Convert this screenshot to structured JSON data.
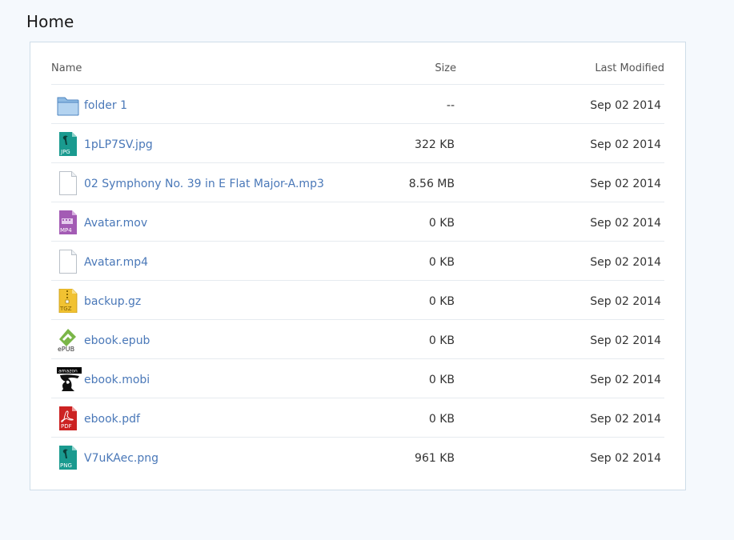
{
  "page": {
    "title": "Home"
  },
  "table": {
    "headers": {
      "name": "Name",
      "size": "Size",
      "modified": "Last Modified"
    },
    "rows": [
      {
        "icon": "folder-icon",
        "name": "folder 1",
        "size": "--",
        "modified": "Sep 02 2014"
      },
      {
        "icon": "jpg-file-icon",
        "icon_label": "JPG",
        "name": "1pLP7SV.jpg",
        "size": "322 KB",
        "modified": "Sep 02 2014"
      },
      {
        "icon": "generic-file-icon",
        "name": "02 Symphony No. 39 in E Flat Major-A.mp3",
        "size": "8.56 MB",
        "modified": "Sep 02 2014"
      },
      {
        "icon": "mp4-file-icon",
        "icon_label": "MP4",
        "name": "Avatar.mov",
        "size": "0 KB",
        "modified": "Sep 02 2014"
      },
      {
        "icon": "generic-file-icon",
        "name": "Avatar.mp4",
        "size": "0 KB",
        "modified": "Sep 02 2014"
      },
      {
        "icon": "tgz-file-icon",
        "icon_label": "TGZ",
        "name": "backup.gz",
        "size": "0 KB",
        "modified": "Sep 02 2014"
      },
      {
        "icon": "epub-file-icon",
        "icon_label": "ePUB",
        "name": "ebook.epub",
        "size": "0 KB",
        "modified": "Sep 02 2014"
      },
      {
        "icon": "amazon-file-icon",
        "icon_label": "amazon",
        "name": "ebook.mobi",
        "size": "0 KB",
        "modified": "Sep 02 2014"
      },
      {
        "icon": "pdf-file-icon",
        "icon_label": "PDF",
        "name": "ebook.pdf",
        "size": "0 KB",
        "modified": "Sep 02 2014"
      },
      {
        "icon": "png-file-icon",
        "icon_label": "PNG",
        "name": "V7uKAec.png",
        "size": "961 KB",
        "modified": "Sep 02 2014"
      }
    ]
  },
  "colors": {
    "link": "#4a78b8",
    "page_background": "#f5f9fd",
    "panel_border": "#cfdde9",
    "image_icon": "#1a9a8f",
    "video_icon": "#a35bb4",
    "archive_icon": "#f1c232",
    "epub_icon": "#7ab648",
    "pdf_icon": "#cc2222"
  }
}
